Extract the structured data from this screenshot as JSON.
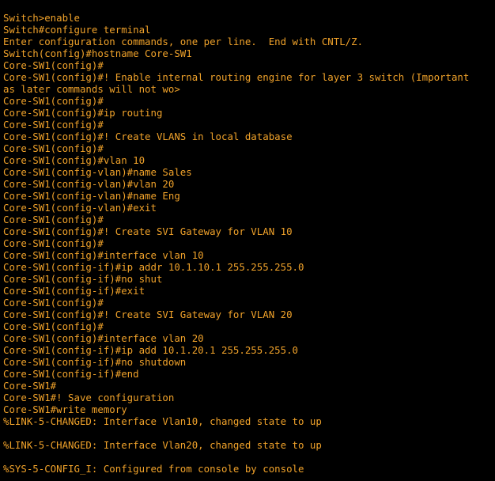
{
  "terminal": {
    "text_color": "#f0a22a",
    "background_color": "#000000",
    "lines": [
      "Switch>enable",
      "Switch#configure terminal",
      "Enter configuration commands, one per line.  End with CNTL/Z.",
      "Switch(config)#hostname Core-SW1",
      "Core-SW1(config)#",
      "Core-SW1(config)#! Enable internal routing engine for layer 3 switch (Important",
      "as later commands will not wo>",
      "Core-SW1(config)#",
      "Core-SW1(config)#ip routing",
      "Core-SW1(config)#",
      "Core-SW1(config)#! Create VLANS in local database",
      "Core-SW1(config)#",
      "Core-SW1(config)#vlan 10",
      "Core-SW1(config-vlan)#name Sales",
      "Core-SW1(config-vlan)#vlan 20",
      "Core-SW1(config-vlan)#name Eng",
      "Core-SW1(config-vlan)#exit",
      "Core-SW1(config)#",
      "Core-SW1(config)#! Create SVI Gateway for VLAN 10",
      "Core-SW1(config)#",
      "Core-SW1(config)#interface vlan 10",
      "Core-SW1(config-if)#ip addr 10.1.10.1 255.255.255.0",
      "Core-SW1(config-if)#no shut",
      "Core-SW1(config-if)#exit",
      "Core-SW1(config)#",
      "Core-SW1(config)#! Create SVI Gateway for VLAN 20",
      "Core-SW1(config)#",
      "Core-SW1(config)#interface vlan 20",
      "Core-SW1(config-if)#ip add 10.1.20.1 255.255.255.0",
      "Core-SW1(config-if)#no shutdown",
      "Core-SW1(config-if)#end",
      "Core-SW1#",
      "Core-SW1#! Save configuration",
      "Core-SW1#write memory",
      "%LINK-5-CHANGED: Interface Vlan10, changed state to up",
      "",
      "%LINK-5-CHANGED: Interface Vlan20, changed state to up",
      "",
      "%SYS-5-CONFIG_I: Configured from console by console"
    ]
  }
}
